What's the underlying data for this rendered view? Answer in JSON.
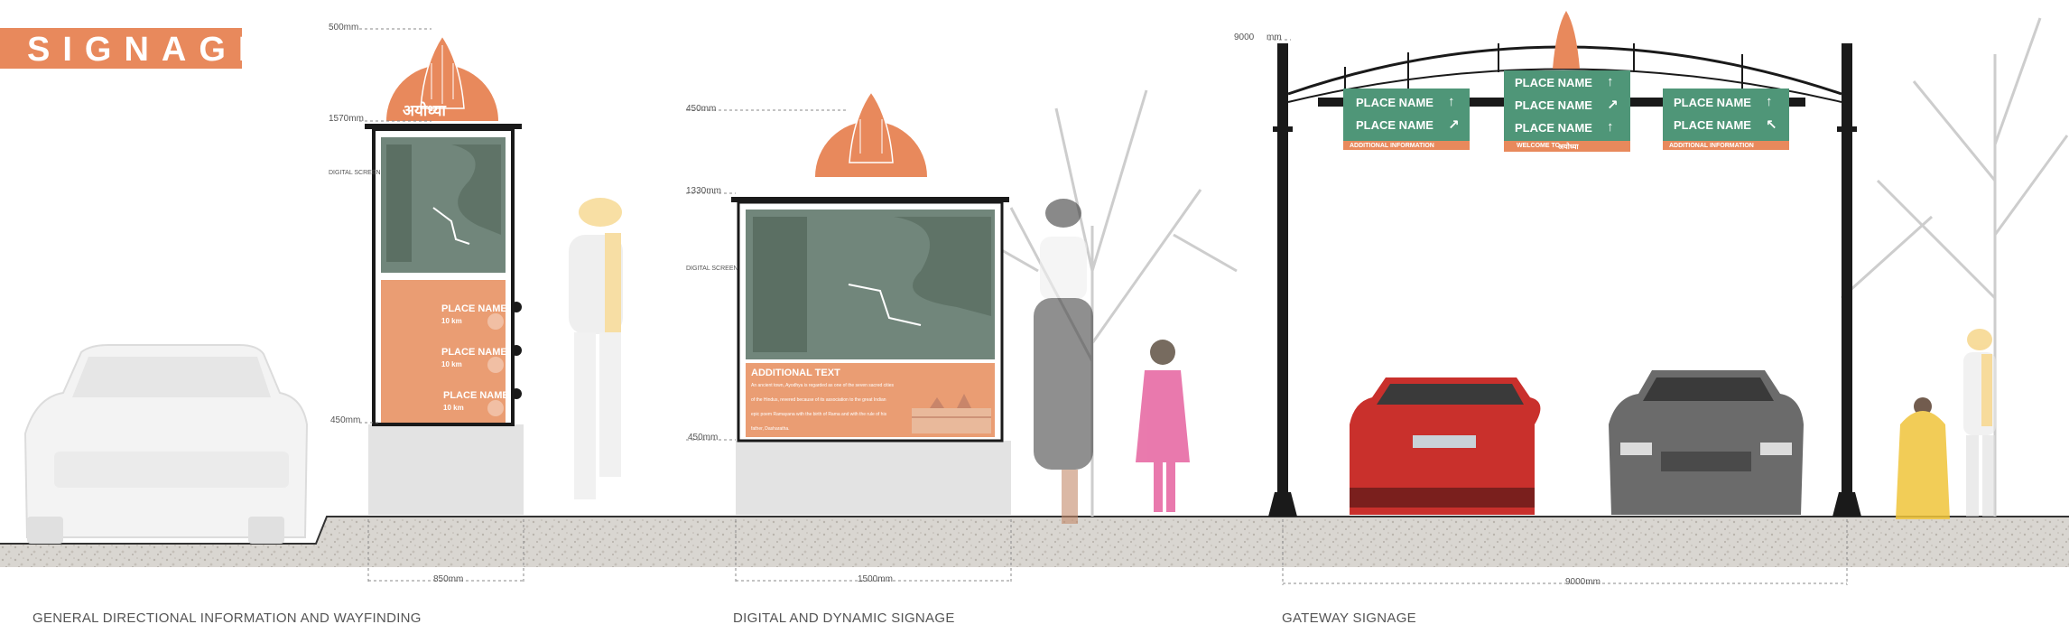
{
  "title": "SIGNAGE",
  "dimensions": {
    "d500": "500mm",
    "d1570": "1570mm",
    "d450a": "450mm",
    "d450b": "450mm",
    "d1330": "1330mm",
    "d450c": "450mm",
    "d9000": "9000",
    "dmm": "mm",
    "w850": "850mm",
    "w1500": "1500mm",
    "w9000": "9000mm",
    "digital_screen_a": "DIGITAL SCREEN",
    "digital_screen_b": "DIGITAL SCREEN"
  },
  "captions": {
    "left": "GENERAL DIRECTIONAL INFORMATION AND WAYFINDING",
    "middle": "DIGITAL AND DYNAMIC SIGNAGE",
    "right": "GATEWAY SIGNAGE"
  },
  "hindi_text": "अयोध्या",
  "totem_sign": {
    "items": [
      {
        "name": "PLACE NAME",
        "distance": "10 km"
      },
      {
        "name": "PLACE NAME",
        "distance": "10 km"
      },
      {
        "name": "PLACE NAME",
        "distance": "10 km"
      }
    ]
  },
  "digital_sign": {
    "heading": "ADDITIONAL TEXT",
    "paragraph": [
      "An ancient town, Ayodhya is regarded as one of the seven sacred cities",
      "of the Hindus, revered because of its association to the great Indian",
      "epic poem Ramayana with the birth of Rama and with the rule of his",
      "father, Dasharatha."
    ]
  },
  "gateway": {
    "panels": [
      {
        "rows": [
          {
            "name": "PLACE NAME",
            "arrow": "↑"
          },
          {
            "name": "PLACE NAME",
            "arrow": "↗"
          }
        ],
        "footer": "ADDITIONAL INFORMATION"
      },
      {
        "rows": [
          {
            "name": "PLACE NAME",
            "arrow": "↑"
          },
          {
            "name": "PLACE NAME",
            "arrow": "↗"
          },
          {
            "name": "PLACE NAME",
            "arrow": "↑"
          }
        ],
        "footer": "WELCOME TO"
      },
      {
        "rows": [
          {
            "name": "PLACE NAME",
            "arrow": "↑"
          },
          {
            "name": "PLACE NAME",
            "arrow": "↖"
          }
        ],
        "footer": "ADDITIONAL INFORMATION"
      }
    ]
  },
  "colors": {
    "accent_orange": "#e8895c",
    "sign_green": "#4f9678",
    "screen_green": "#71867b",
    "frame": "#1a1a1a"
  }
}
